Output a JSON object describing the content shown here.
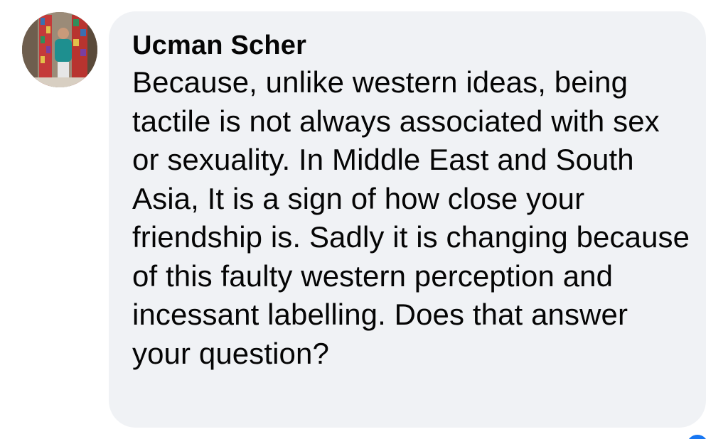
{
  "comment": {
    "author": "Ucman Scher",
    "text": "Because, unlike western ideas, being tactile is not always associated with sex or sexuality. In Middle East and South Asia, It is a sign of how close your friendship is. Sadly it is changing because of this faulty western perception and incessant labelling. Does that answer your question?"
  },
  "colors": {
    "bubble_background": "#f0f2f5",
    "text": "#050505",
    "reaction_blue": "#1877f2"
  },
  "icons": {
    "reaction": "like-reaction-icon"
  }
}
